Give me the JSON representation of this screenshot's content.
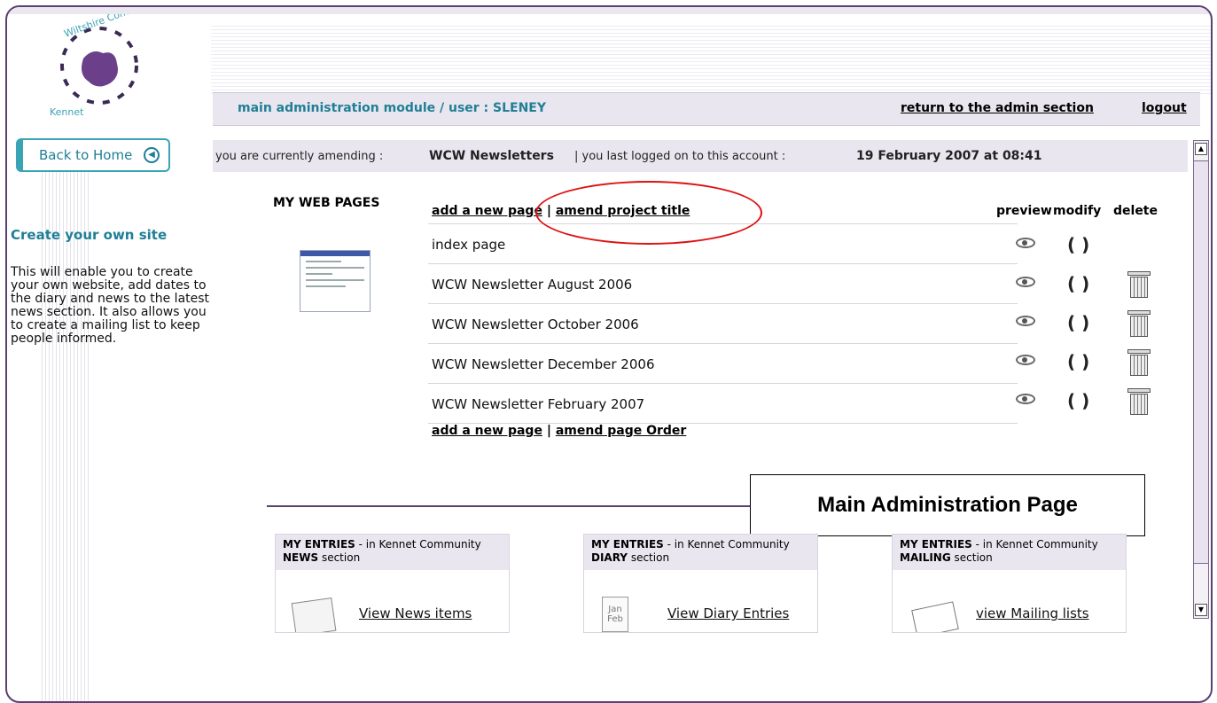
{
  "logo": {
    "text_top": "Wiltshire Community Web",
    "text_bottom": "Kennet"
  },
  "sidebar": {
    "back_button": "Back to Home",
    "title": "Create your own site",
    "description": "This will enable you to create your own website, add dates to the diary and news to the latest news section. It also allows you to create a mailing list to keep people informed."
  },
  "admin_bar": {
    "title": "main administration module / user : SLENEY",
    "return_link": "return to the admin section",
    "logout": "logout"
  },
  "amend_bar": {
    "prefix": "you are currently amending :",
    "project": "WCW Newsletters",
    "sep": "| you last logged on to this account :",
    "date": "19 February 2007 at 08:41"
  },
  "web_pages": {
    "title": "MY WEB PAGES",
    "add_page": "add a new page",
    "amend_title": "amend project title",
    "amend_order": "amend page Order",
    "separator": "|",
    "columns": {
      "preview": "preview",
      "modify": "modify",
      "delete": "delete"
    },
    "pages": [
      {
        "name": "index page",
        "deletable": false
      },
      {
        "name": "WCW Newsletter August 2006",
        "deletable": true
      },
      {
        "name": "WCW Newsletter October 2006",
        "deletable": true
      },
      {
        "name": "WCW Newsletter December 2006",
        "deletable": true
      },
      {
        "name": "WCW Newsletter February 2007",
        "deletable": true
      }
    ]
  },
  "callout": "Main Administration Page",
  "entries": [
    {
      "heading": "MY ENTRIES",
      "sub": "- in Kennet Community",
      "section": "NEWS",
      "suffix": "section",
      "link": "View News items"
    },
    {
      "heading": "MY ENTRIES",
      "sub": "- in Kennet Community",
      "section": "DIARY",
      "suffix": "section",
      "link": "View Diary Entries",
      "cal_top": "Jan",
      "cal_bottom": "Feb"
    },
    {
      "heading": "MY ENTRIES",
      "sub": "- in Kennet Community",
      "section": "MAILING",
      "suffix": "section",
      "link": "view Mailing lists"
    }
  ]
}
